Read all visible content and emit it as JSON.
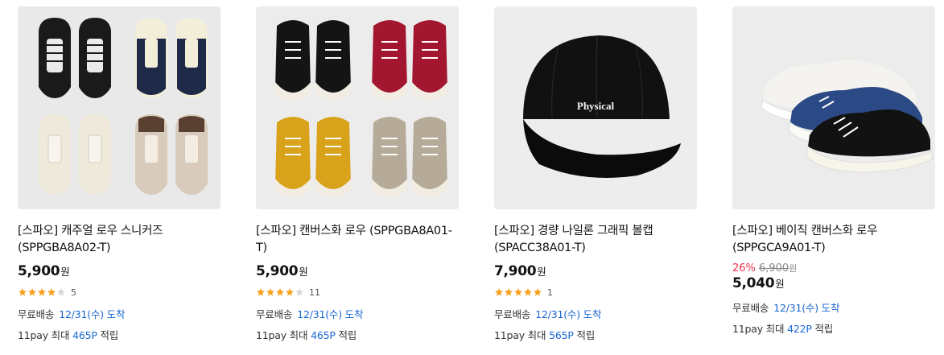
{
  "products": [
    {
      "title": "[스파오] 캐주얼 로우 스니커즈 (SPPGBA8A02-T)",
      "price": "5,900",
      "currency": "원",
      "rating": 4,
      "review_count": "5",
      "shipping_label": "무료배송",
      "shipping_date": "12/31(수) 도착",
      "pay_prefix": "11pay 최대",
      "pay_points": "465P",
      "pay_suffix": "적립",
      "image_desc": "casual-low-sneakers"
    },
    {
      "title": "[스파오] 캔버스화 로우 (SPPGBA8A01-T)",
      "price": "5,900",
      "currency": "원",
      "rating": 4,
      "review_count": "11",
      "shipping_label": "무료배송",
      "shipping_date": "12/31(수) 도착",
      "pay_prefix": "11pay 최대",
      "pay_points": "465P",
      "pay_suffix": "적립",
      "image_desc": "canvas-low-sneakers"
    },
    {
      "title": "[스파오] 경량 나일론 그래픽 볼캡 (SPACC38A01-T)",
      "price": "7,900",
      "currency": "원",
      "rating": 5,
      "review_count": "1",
      "shipping_label": "무료배송",
      "shipping_date": "12/31(수) 도착",
      "pay_prefix": "11pay 최대",
      "pay_points": "565P",
      "pay_suffix": "적립",
      "image_text": "Physical",
      "image_desc": "black-ballcap"
    },
    {
      "title": "[스파오] 베이직 캔버스화 로우 (SPPGCA9A01-T)",
      "discount": "26%",
      "original_price": "6,900",
      "price": "5,040",
      "currency": "원",
      "shipping_label": "무료배송",
      "shipping_date": "12/31(수) 도착",
      "pay_prefix": "11pay 최대",
      "pay_points": "422P",
      "pay_suffix": "적립",
      "image_desc": "basic-canvas-sneakers"
    }
  ],
  "colors": {
    "discount": "#e8334a",
    "link_blue": "#1967d2",
    "star": "#f7a21b",
    "thumb_bg": "#ededed"
  }
}
